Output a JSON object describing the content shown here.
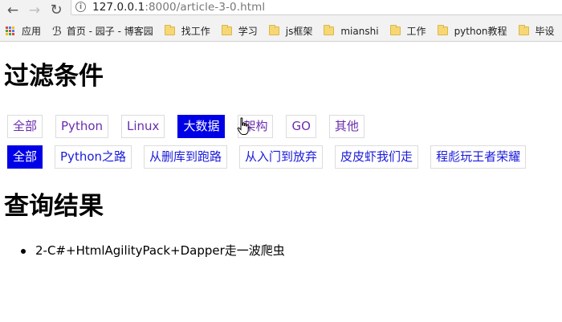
{
  "browser": {
    "url_host": "127.0.0.1",
    "url_path": ":8000/article-3-0.html",
    "bookmarks": [
      {
        "label": "应用",
        "icon": "apps-icon"
      },
      {
        "label": "首页 - 园子 - 博客园",
        "icon": "site-icon"
      },
      {
        "label": "找工作",
        "icon": "folder-icon"
      },
      {
        "label": "学习",
        "icon": "folder-icon"
      },
      {
        "label": "js框架",
        "icon": "folder-icon"
      },
      {
        "label": "mianshi",
        "icon": "folder-icon"
      },
      {
        "label": "工作",
        "icon": "folder-icon"
      },
      {
        "label": "python教程",
        "icon": "folder-icon"
      },
      {
        "label": "毕设",
        "icon": "folder-icon"
      }
    ]
  },
  "page": {
    "filter_title": "过滤条件",
    "result_title": "查询结果",
    "categories": [
      {
        "label": "全部",
        "active": false
      },
      {
        "label": "Python",
        "active": false
      },
      {
        "label": "Linux",
        "active": false
      },
      {
        "label": "大数据",
        "active": true
      },
      {
        "label": "架构",
        "active": false
      },
      {
        "label": "GO",
        "active": false
      },
      {
        "label": "其他",
        "active": false
      }
    ],
    "subcategories": [
      {
        "label": "全部",
        "active": true
      },
      {
        "label": "Python之路",
        "active": false
      },
      {
        "label": "从删库到跑路",
        "active": false
      },
      {
        "label": "从入门到放弃",
        "active": false
      },
      {
        "label": "皮皮虾我们走",
        "active": false
      },
      {
        "label": "程彪玩王者荣耀",
        "active": false
      }
    ],
    "results": [
      "2-C#+HtmlAgilityPack+Dapper走一波爬虫"
    ]
  },
  "colors": {
    "active_bg": "#0000e6",
    "link_visited": "#6a2cae",
    "link": "#1a1adb"
  }
}
